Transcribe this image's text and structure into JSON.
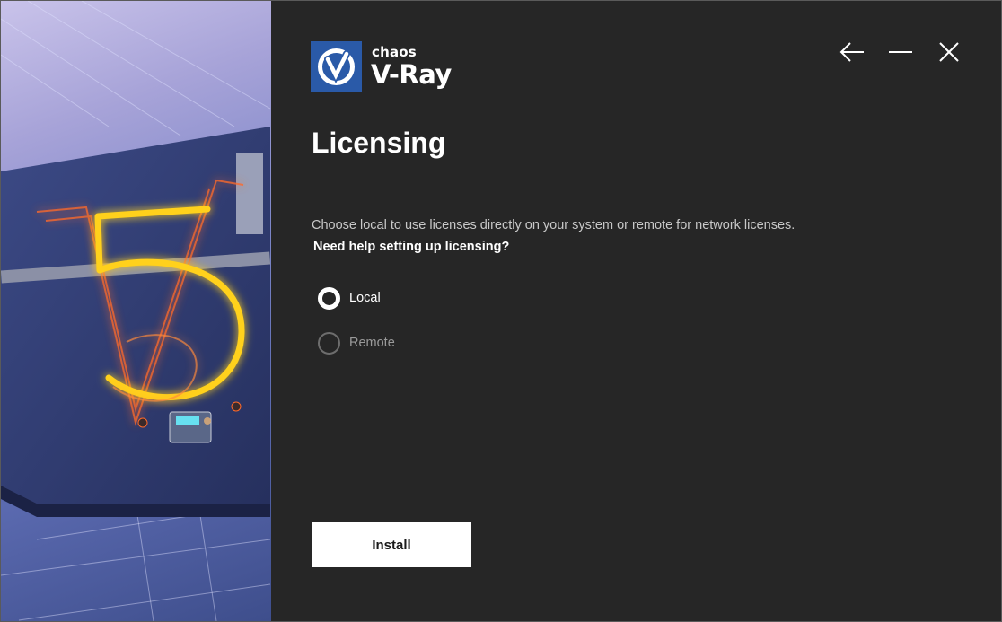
{
  "header": {
    "brand": "chaos",
    "product": "V-Ray",
    "brand_color": "#2a5aa8"
  },
  "window_controls": {
    "back_icon": "arrow-left-icon",
    "minimize_icon": "minimize-icon",
    "close_icon": "close-icon"
  },
  "page": {
    "title": "Licensing",
    "description": "Choose local to use licenses directly on your system or remote for network licenses.",
    "help_link": "Need help setting up licensing?"
  },
  "license_options": [
    {
      "label": "Local",
      "selected": true
    },
    {
      "label": "Remote",
      "selected": false
    }
  ],
  "actions": {
    "install_label": "Install"
  },
  "colors": {
    "background": "#262626",
    "accent_neon": "#ffd11a",
    "button_bg": "#ffffff"
  }
}
